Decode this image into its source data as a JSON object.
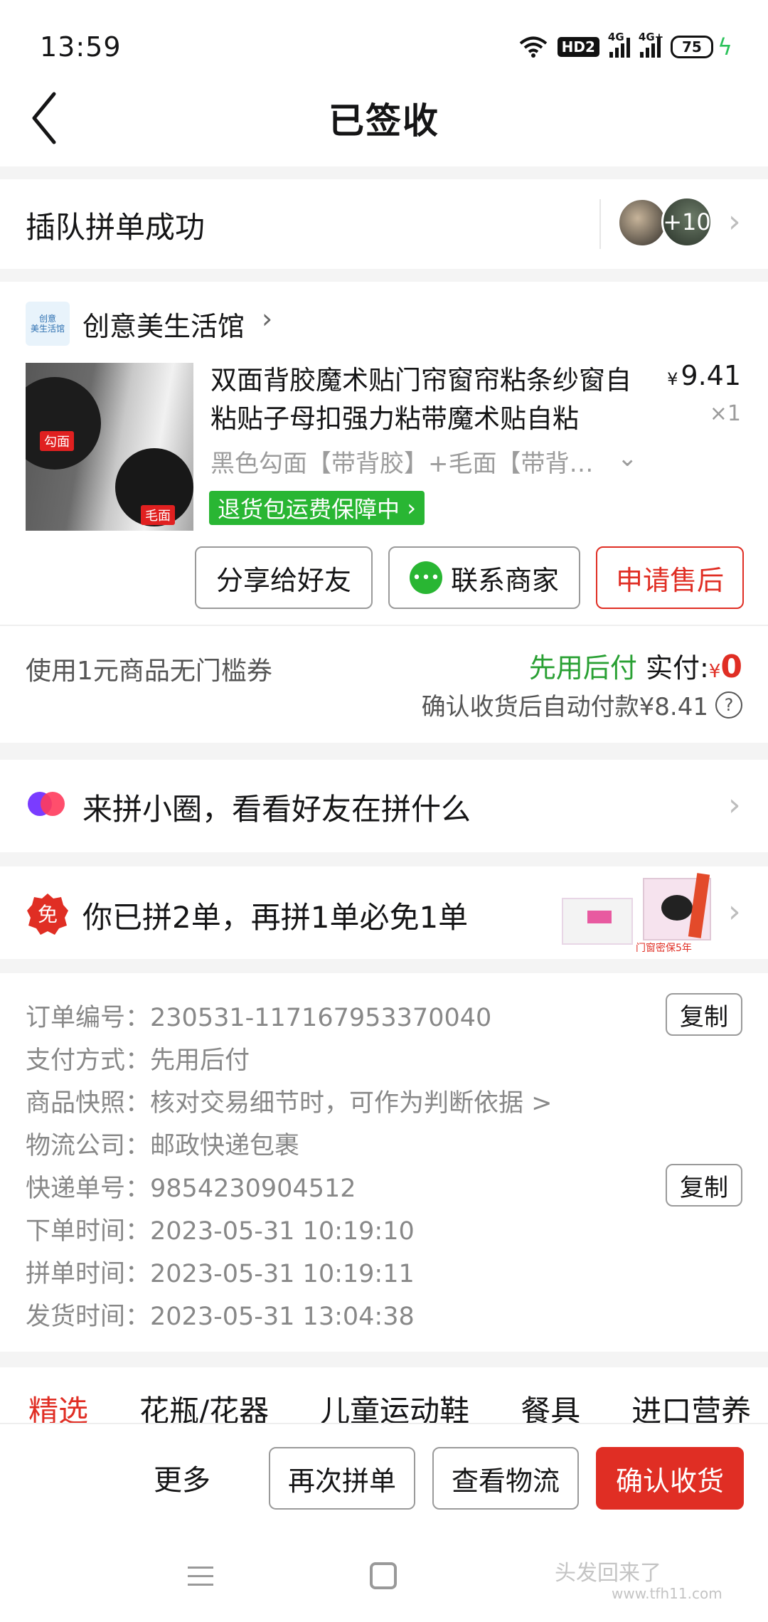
{
  "status_bar": {
    "time": "13:59",
    "hd_label": "HD2",
    "net1": "4G",
    "net2": "4G+",
    "battery": "75"
  },
  "nav": {
    "title": "已签收"
  },
  "group": {
    "title": "插队拼单成功",
    "more_count": "+10"
  },
  "store": {
    "logo_text": "创意\n美生活馆",
    "name": "创意美生活馆",
    "product": {
      "title": "双面背胶魔术贴门帘窗帘粘条纱窗自粘贴子母扣强力粘带魔术贴自粘",
      "currency": "¥",
      "price": "9.41",
      "qty": "×1",
      "sku": "黑色勾面【带背胶】+毛面【带背…",
      "guarantee": "退货包运费保障中",
      "img_tag_hook": "勾面",
      "img_tag_loop": "毛面"
    },
    "actions": {
      "share": "分享给好友",
      "contact": "联系商家",
      "after_sale": "申请售后"
    }
  },
  "payment": {
    "coupon": "使用1元商品无门槛券",
    "pay_later": "先用后付",
    "paid_label": "实付:",
    "currency": "¥",
    "paid_amount": "0",
    "auto_pay": "确认收货后自动付款¥8.41"
  },
  "circle": {
    "text": "来拼小圈，看看好友在拼什么"
  },
  "free": {
    "badge": "免",
    "text": "你已拼2单，再拼1单必免1单",
    "promo_caption": "门窗密保5年"
  },
  "order_info": {
    "rows": [
      {
        "label": "订单编号：",
        "value": "230531-117167953370040"
      },
      {
        "label": "支付方式：",
        "value": "先用后付"
      },
      {
        "label": "商品快照：",
        "value": "核对交易细节时，可作为判断依据 >"
      },
      {
        "label": "物流公司：",
        "value": "邮政快递包裹"
      },
      {
        "label": "快递单号：",
        "value": "9854230904512"
      },
      {
        "label": "下单时间：",
        "value": "2023-05-31 10:19:10"
      },
      {
        "label": "拼单时间：",
        "value": "2023-05-31 10:19:11"
      },
      {
        "label": "发货时间：",
        "value": "2023-05-31 13:04:38"
      }
    ],
    "copy_label": "复制"
  },
  "tabs": [
    "精选",
    "花瓶/花器",
    "儿童运动鞋",
    "餐具",
    "进口营养"
  ],
  "bottom": {
    "more": "更多",
    "regroup": "再次拼单",
    "logistics": "查看物流",
    "confirm": "确认收货"
  },
  "watermark": {
    "text": "头发回来了",
    "url": "www.tfh11.com"
  },
  "colors": {
    "accent_red": "#e02e24",
    "green": "#29b633"
  }
}
